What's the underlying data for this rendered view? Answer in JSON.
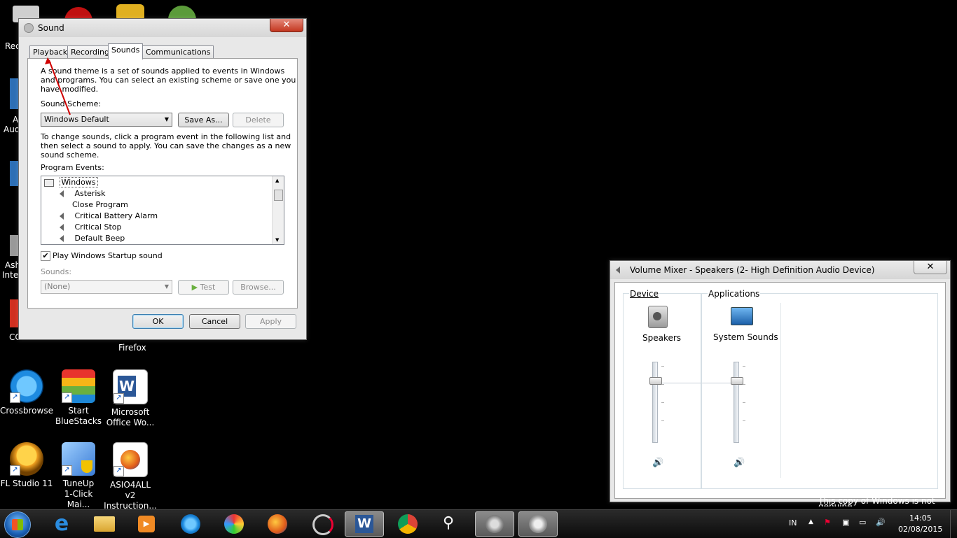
{
  "desktop": {
    "icons": [
      {
        "label": "Crossbrowse",
        "color": "#1e8be0"
      },
      {
        "label": "Start\nBlueStacks",
        "color": "#6ab03f"
      },
      {
        "label": "Microsoft\nOffice Wo...",
        "color": "#2b5797"
      },
      {
        "label": "FL Studio 11",
        "color": "#f0a020"
      },
      {
        "label": "TuneUp\n1-Click Mai...",
        "color": "#3a7bd5"
      },
      {
        "label": "ASIO4ALL v2\nInstruction...",
        "color": "#e05b1a"
      }
    ],
    "partial_labels": [
      "Rec",
      "A",
      "Aud",
      "Ash",
      "Inte",
      "CC",
      "Firefox"
    ],
    "watermark": "This copy of Windows is not genuine"
  },
  "sound_dialog": {
    "title": "Sound",
    "tabs": [
      "Playback",
      "Recording",
      "Sounds",
      "Communications"
    ],
    "active_tab": "Sounds",
    "description": "A sound theme is a set of sounds applied to events in Windows and programs.  You can select an existing scheme or save one you have modified.",
    "description_lines": [
      "A sound theme is a set of sounds applied to events in Windows",
      "and programs.  You can select an existing scheme or save one you",
      "have modified."
    ],
    "scheme_label": "Sound Scheme:",
    "scheme_value": "Windows Default",
    "save_as_label": "Save As...",
    "delete_label": "Delete",
    "instructions_lines": [
      "To change sounds, click a program event in the following list and",
      "then select a sound to apply.  You can save the changes as a new",
      "sound scheme."
    ],
    "events_label": "Program Events:",
    "events_group": "Windows",
    "events": [
      {
        "name": "Asterisk",
        "has_sound": true
      },
      {
        "name": "Close Program",
        "has_sound": false
      },
      {
        "name": "Critical Battery Alarm",
        "has_sound": true
      },
      {
        "name": "Critical Stop",
        "has_sound": true
      },
      {
        "name": "Default Beep",
        "has_sound": true
      }
    ],
    "startup_checkbox_label": "Play Windows Startup sound",
    "startup_checked": true,
    "sounds_label": "Sounds:",
    "sounds_value": "(None)",
    "test_label": "Test",
    "browse_label": "Browse...",
    "ok_label": "OK",
    "cancel_label": "Cancel",
    "apply_label": "Apply"
  },
  "volume_mixer": {
    "title": "Volume Mixer - Speakers (2- High Definition Audio Device)",
    "device_header": "Device",
    "applications_header": "Applications",
    "device_name": "Speakers",
    "app_name": "System Sounds",
    "device_level": 0.75,
    "app_level": 0.75
  },
  "taskbar": {
    "lang": "IN",
    "time": "14:05",
    "date": "02/08/2015",
    "colors": {
      "accent": "#3c7fb1",
      "annotation": "#d00000"
    }
  }
}
